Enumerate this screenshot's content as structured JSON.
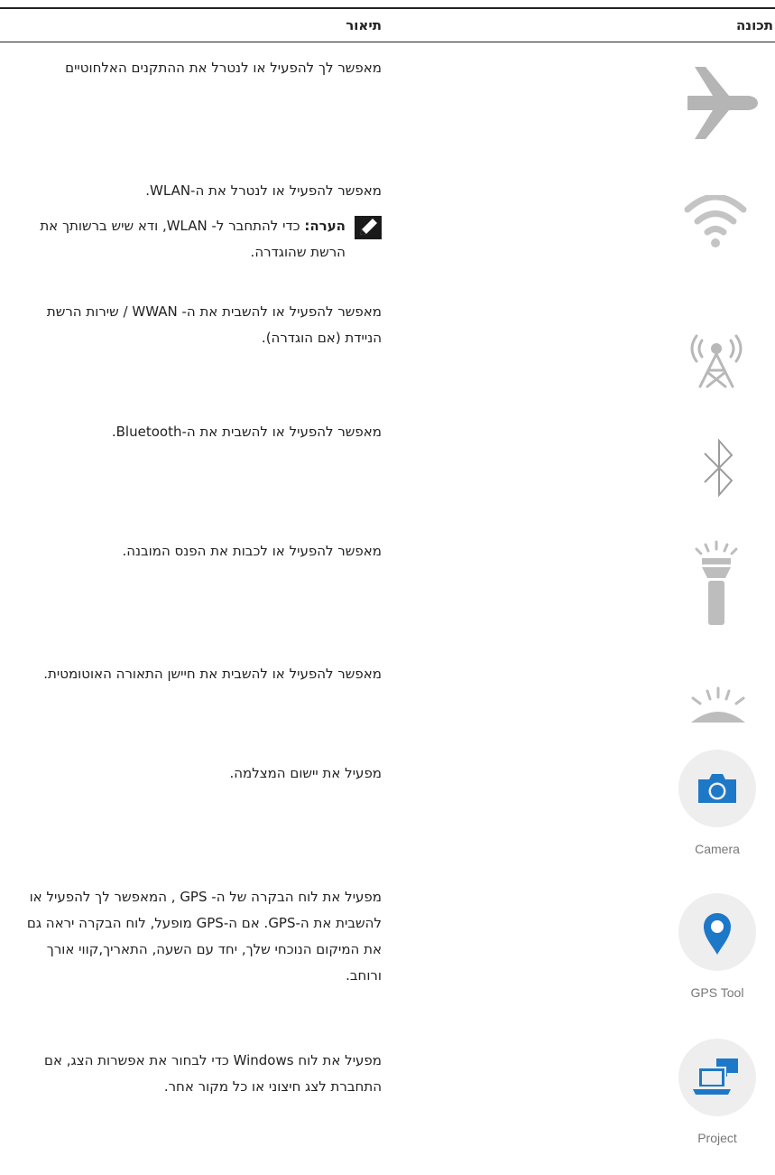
{
  "header": {
    "feature": "תכונה",
    "description": "תיאור"
  },
  "rows": [
    {
      "icon": "airplane-icon",
      "description": "מאפשר לך להפעיל או לנטרל את ההתקנים האלחוטיים"
    },
    {
      "icon": "wifi-icon",
      "description": "מאפשר להפעיל או לנטרל את ה-WLAN.",
      "note": {
        "label": "הערה:",
        "text": "כדי להתחבר ל- WLAN, ודא שיש ברשותך את הרשת שהוגדרה."
      }
    },
    {
      "icon": "cellular-tower-icon",
      "description": "מאפשר להפעיל או להשבית את ה- WWAN / שירות הרשת הניידת (אם הוגדרה)."
    },
    {
      "icon": "bluetooth-icon",
      "description": "מאפשר להפעיל או להשבית את ה-Bluetooth."
    },
    {
      "icon": "flashlight-icon",
      "description": "מאפשר להפעיל או לכבות את הפנס המובנה."
    },
    {
      "icon": "auto-light-sensor-icon",
      "description": "מאפשר להפעיל או להשבית את חיישן התאורה האוטומטית."
    },
    {
      "icon": "camera-icon",
      "caption": "Camera",
      "description": "מפעיל את יישום המצלמה."
    },
    {
      "icon": "gps-pin-icon",
      "caption": "GPS Tool",
      "description": "מפעיל את לוח הבקרה של ה- GPS , המאפשר לך להפעיל או להשבית את ה-GPS. אם ה-GPS מופעל, לוח הבקרה יראה גם את המיקום הנוכחי שלך, יחד עם השעה, התאריך,קווי אורך ורוחב."
    },
    {
      "icon": "project-display-icon",
      "caption": "Project",
      "description": "מפעיל את לוח Windows כדי לבחור את אפשרות הצג, אם התחברת לצג חיצוני או כל מקור אחר."
    }
  ]
}
